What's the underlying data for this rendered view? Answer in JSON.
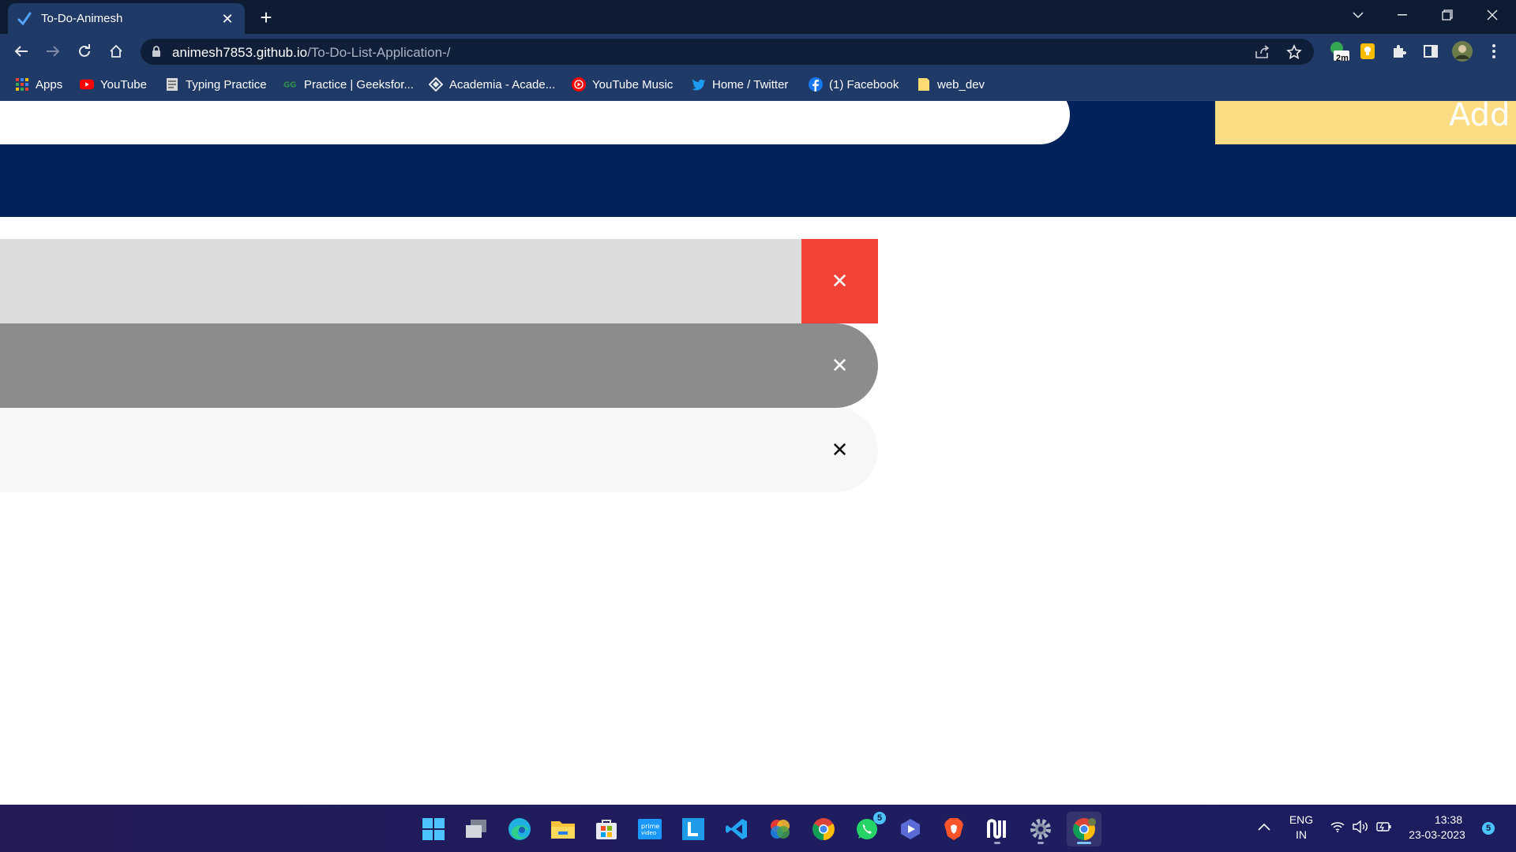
{
  "browser": {
    "tab": {
      "title": "To-Do-Animesh"
    },
    "address": {
      "host": "animesh7853.github.io",
      "path": "/To-Do-List-Application-/"
    },
    "extension_badge": "2m",
    "bookmarks": [
      {
        "label": "Apps",
        "icon": "apps-grid-icon"
      },
      {
        "label": "YouTube",
        "icon": "youtube-icon"
      },
      {
        "label": "Typing Practice",
        "icon": "page-icon"
      },
      {
        "label": "Practice | Geeksfor...",
        "icon": "geeksforgeeks-icon"
      },
      {
        "label": "Academia - Acade...",
        "icon": "academia-icon"
      },
      {
        "label": "YouTube Music",
        "icon": "youtube-music-icon"
      },
      {
        "label": "Home / Twitter",
        "icon": "twitter-icon"
      },
      {
        "label": "(1) Facebook",
        "icon": "facebook-icon"
      },
      {
        "label": "web_dev",
        "icon": "folder-icon"
      }
    ]
  },
  "app": {
    "input_value": "",
    "add_label": "Add",
    "colors": {
      "header": "#00225a",
      "add_button": "#fedc84",
      "delete_active": "#f44336"
    },
    "todos": [
      {
        "text": "",
        "delete_label": "✕"
      },
      {
        "text": "",
        "delete_label": "✕"
      },
      {
        "text": "",
        "delete_label": "✕"
      }
    ]
  },
  "taskbar": {
    "apps": [
      "start-icon",
      "task-view-icon",
      "edge-icon",
      "file-explorer-icon",
      "microsoft-store-icon",
      "prime-video-icon",
      "l-app-icon",
      "vscode-icon",
      "color-app-icon",
      "chrome-icon",
      "whatsapp-icon",
      "video-editor-icon",
      "brave-icon",
      "notion-icon",
      "settings-icon",
      "chrome-profile-icon"
    ],
    "whatsapp_badge": "5",
    "language": {
      "line1": "ENG",
      "line2": "IN"
    },
    "clock": {
      "time": "13:38",
      "date": "23-03-2023"
    },
    "notification_count": "5"
  }
}
